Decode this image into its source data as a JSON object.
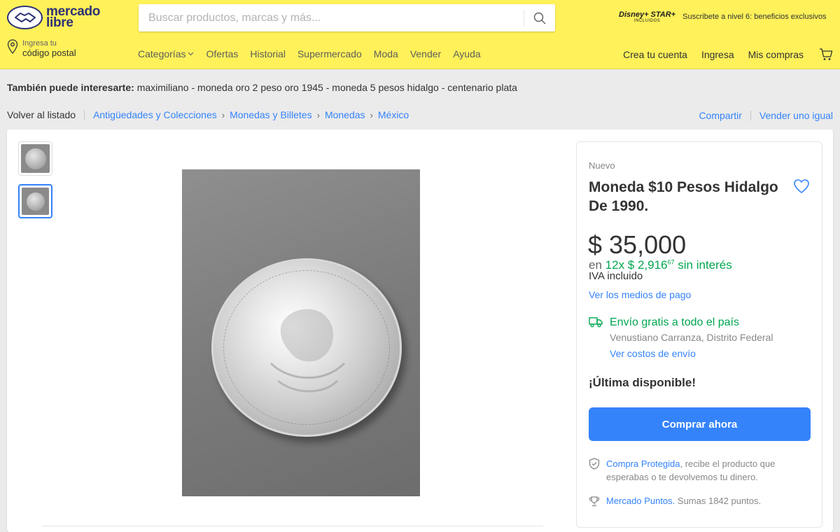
{
  "header": {
    "logo_line1": "mercado",
    "logo_line2": "libre",
    "search_placeholder": "Buscar productos, marcas y más...",
    "promo_brands": "Disney+ STAR+",
    "promo_included": "INCLUIDOS",
    "promo_text": "Suscribete a nivel 6: beneficios exclusivos",
    "location_small": "Ingresa tu",
    "location_big": "código postal",
    "nav": [
      "Categorías",
      "Ofertas",
      "Historial",
      "Supermercado",
      "Moda",
      "Vender",
      "Ayuda"
    ],
    "account": {
      "create": "Crea tu cuenta",
      "login": "Ingresa",
      "purchases": "Mis compras"
    }
  },
  "interest": {
    "label": "También puede interesarte:",
    "items": "maximiliano - moneda oro 2 peso oro 1945 - moneda 5 pesos hidalgo - centenario plata"
  },
  "breadcrumb": {
    "back": "Volver al listado",
    "items": [
      "Antigüedades y Colecciones",
      "Monedas y Billetes",
      "Monedas",
      "México"
    ],
    "share": "Compartir",
    "sell_same": "Vender uno igual"
  },
  "product": {
    "condition": "Nuevo",
    "title": "Moneda $10 Pesos Hidalgo De 1990.",
    "price": "$ 35,000",
    "installments_prefix": "en",
    "installments_value": "12x $ 2,916",
    "installments_cents": "67",
    "installments_suffix": "sin interés",
    "iva": "IVA incluido",
    "payment_methods": "Ver los medios de pago",
    "shipping_main": "Envío gratis a todo el país",
    "shipping_location": "Venustiano Carranza, Distrito Federal",
    "shipping_costs": "Ver costos de envío",
    "stock": "¡Última disponible!",
    "buy_button": "Comprar ahora",
    "protected_link": "Compra Protegida",
    "protected_text": ", recibe el producto que esperabas o te devolvemos tu dinero.",
    "points_link": "Mercado Puntos.",
    "points_text": " Sumas 1842 puntos."
  },
  "colors": {
    "header_bg": "#fff159",
    "accent_blue": "#3483fa",
    "green": "#00a650"
  }
}
